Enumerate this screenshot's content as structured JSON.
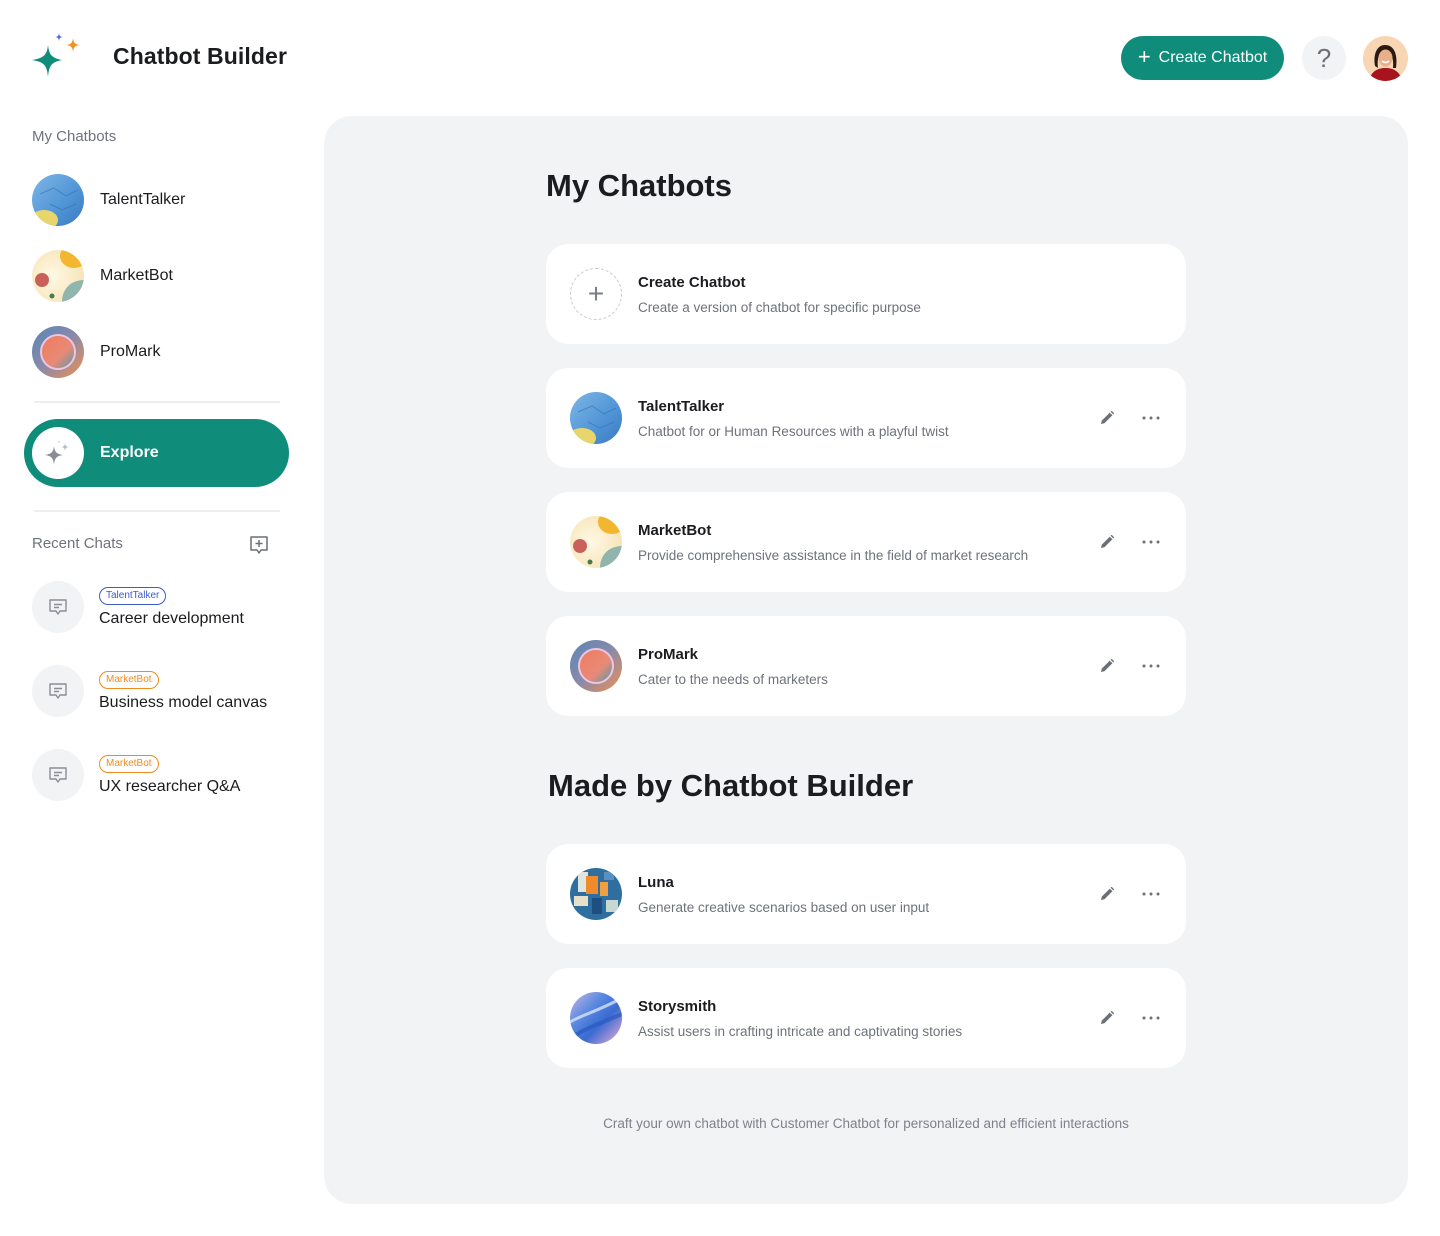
{
  "header": {
    "app_title": "Chatbot Builder",
    "create_button_label": "Create Chatbot",
    "help_label": "?",
    "brand_color": "#0f8c7a"
  },
  "sidebar": {
    "my_chatbots_label": "My Chatbots",
    "chatbots": [
      {
        "name": "TalentTalker",
        "avatar": "talenttalker-avatar"
      },
      {
        "name": "MarketBot",
        "avatar": "marketbot-avatar"
      },
      {
        "name": "ProMark",
        "avatar": "promark-avatar"
      }
    ],
    "explore_label": "Explore",
    "recent_chats_label": "Recent Chats",
    "recent_chats": [
      {
        "tag": "TalentTalker",
        "tag_color": "#3d5cc9",
        "title": "Career development"
      },
      {
        "tag": "MarketBot",
        "tag_color": "#ef8c1e",
        "title": "Business model canvas"
      },
      {
        "tag": "MarketBot",
        "tag_color": "#ef8c1e",
        "title": "UX researcher Q&A"
      }
    ]
  },
  "main": {
    "my_chatbots_heading": "My Chatbots",
    "create_card": {
      "title": "Create Chatbot",
      "description": "Create a version of chatbot for specific purpose"
    },
    "my_chatbots": [
      {
        "name": "TalentTalker",
        "description": "Chatbot for or Human Resources with a playful twist"
      },
      {
        "name": "MarketBot",
        "description": "Provide comprehensive assistance in the field of market research"
      },
      {
        "name": "ProMark",
        "description": "Cater to the needs of marketers"
      }
    ],
    "made_by_heading": "Made by Chatbot Builder",
    "made_by": [
      {
        "name": "Luna",
        "description": "Generate creative scenarios based on user input"
      },
      {
        "name": "Storysmith",
        "description": "Assist users in crafting intricate and captivating stories"
      }
    ],
    "footer_note": "Craft your own chatbot with Customer Chatbot for personalized and efficient interactions"
  }
}
